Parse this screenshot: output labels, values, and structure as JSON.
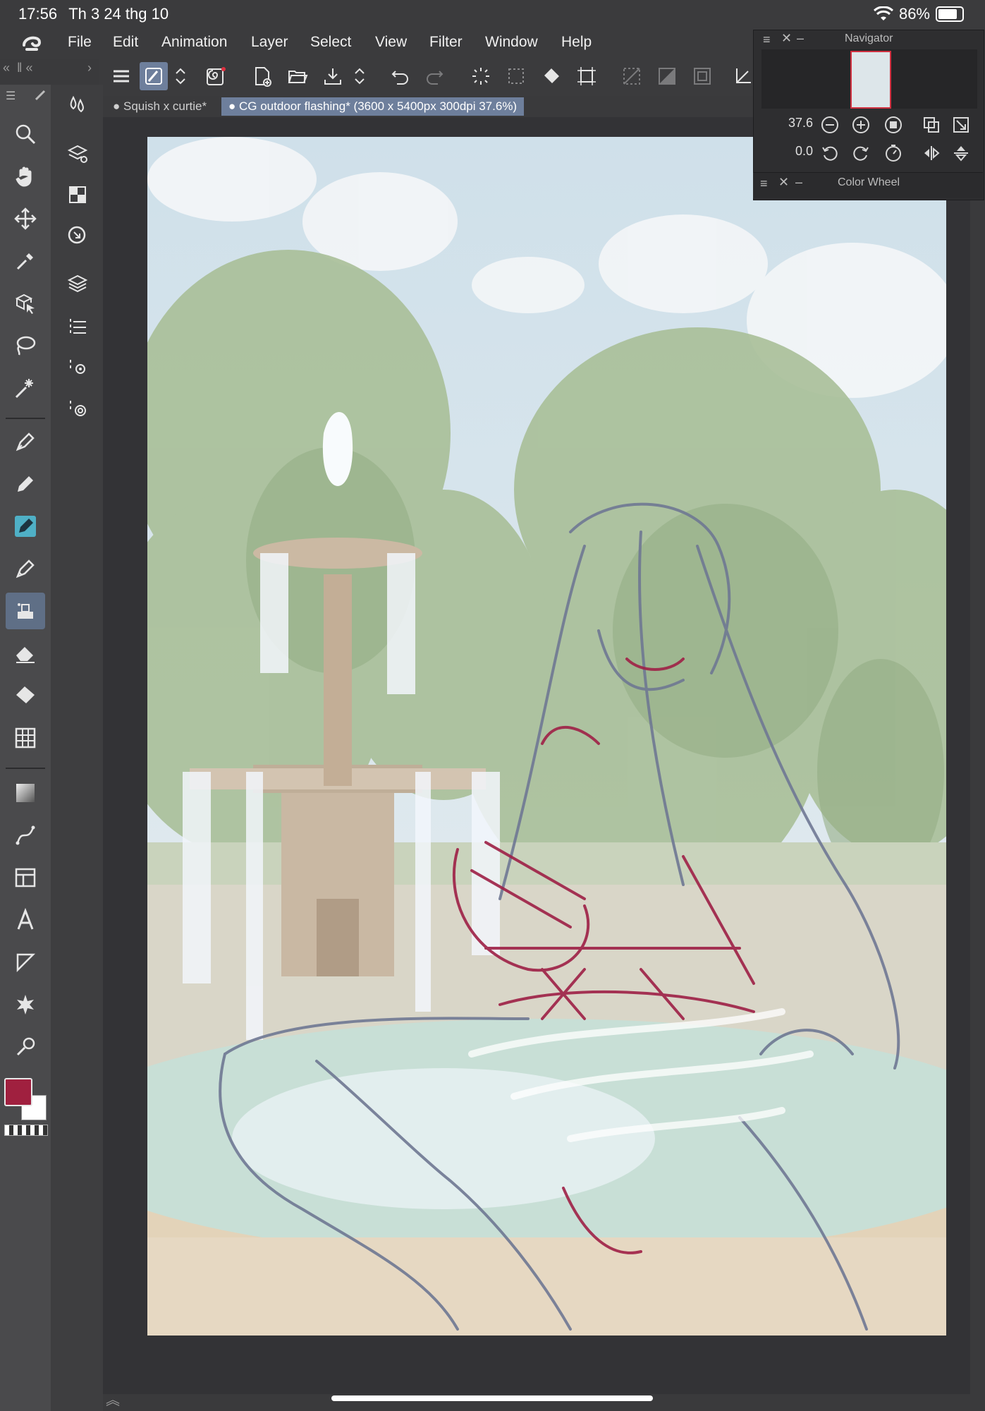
{
  "status": {
    "time": "17:56",
    "date": "Th 3 24 thg 10",
    "battery": "86%"
  },
  "menu": [
    "File",
    "Edit",
    "Animation",
    "Layer",
    "Select",
    "View",
    "Filter",
    "Window",
    "Help"
  ],
  "tabs": [
    {
      "label": "Squish x curtie*"
    },
    {
      "label": "CG outdoor flashing* (3600 x 5400px 300dpi 37.6%)"
    }
  ],
  "navigator": {
    "title": "Navigator",
    "zoom": "37.6",
    "rotation": "0.0"
  },
  "color_wheel": {
    "title": "Color Wheel"
  },
  "colors": {
    "main": "#a0203f",
    "sub": "#ffffff",
    "accent": "#6e7f9c"
  },
  "icons": {
    "tools": [
      "zoom-icon",
      "hand-icon",
      "move-icon",
      "eyedropper-icon",
      "object-select-icon",
      "lasso-icon",
      "magic-wand-icon",
      "pen-icon",
      "pencil-icon",
      "brush-icon",
      "airbrush-icon",
      "decoration-icon",
      "eraser-icon",
      "fill-icon",
      "grid-fill-icon",
      "gradient-icon",
      "vector-icon",
      "frame-icon",
      "text-icon",
      "balloon-icon",
      "effect-icon",
      "correct-line-icon"
    ]
  }
}
